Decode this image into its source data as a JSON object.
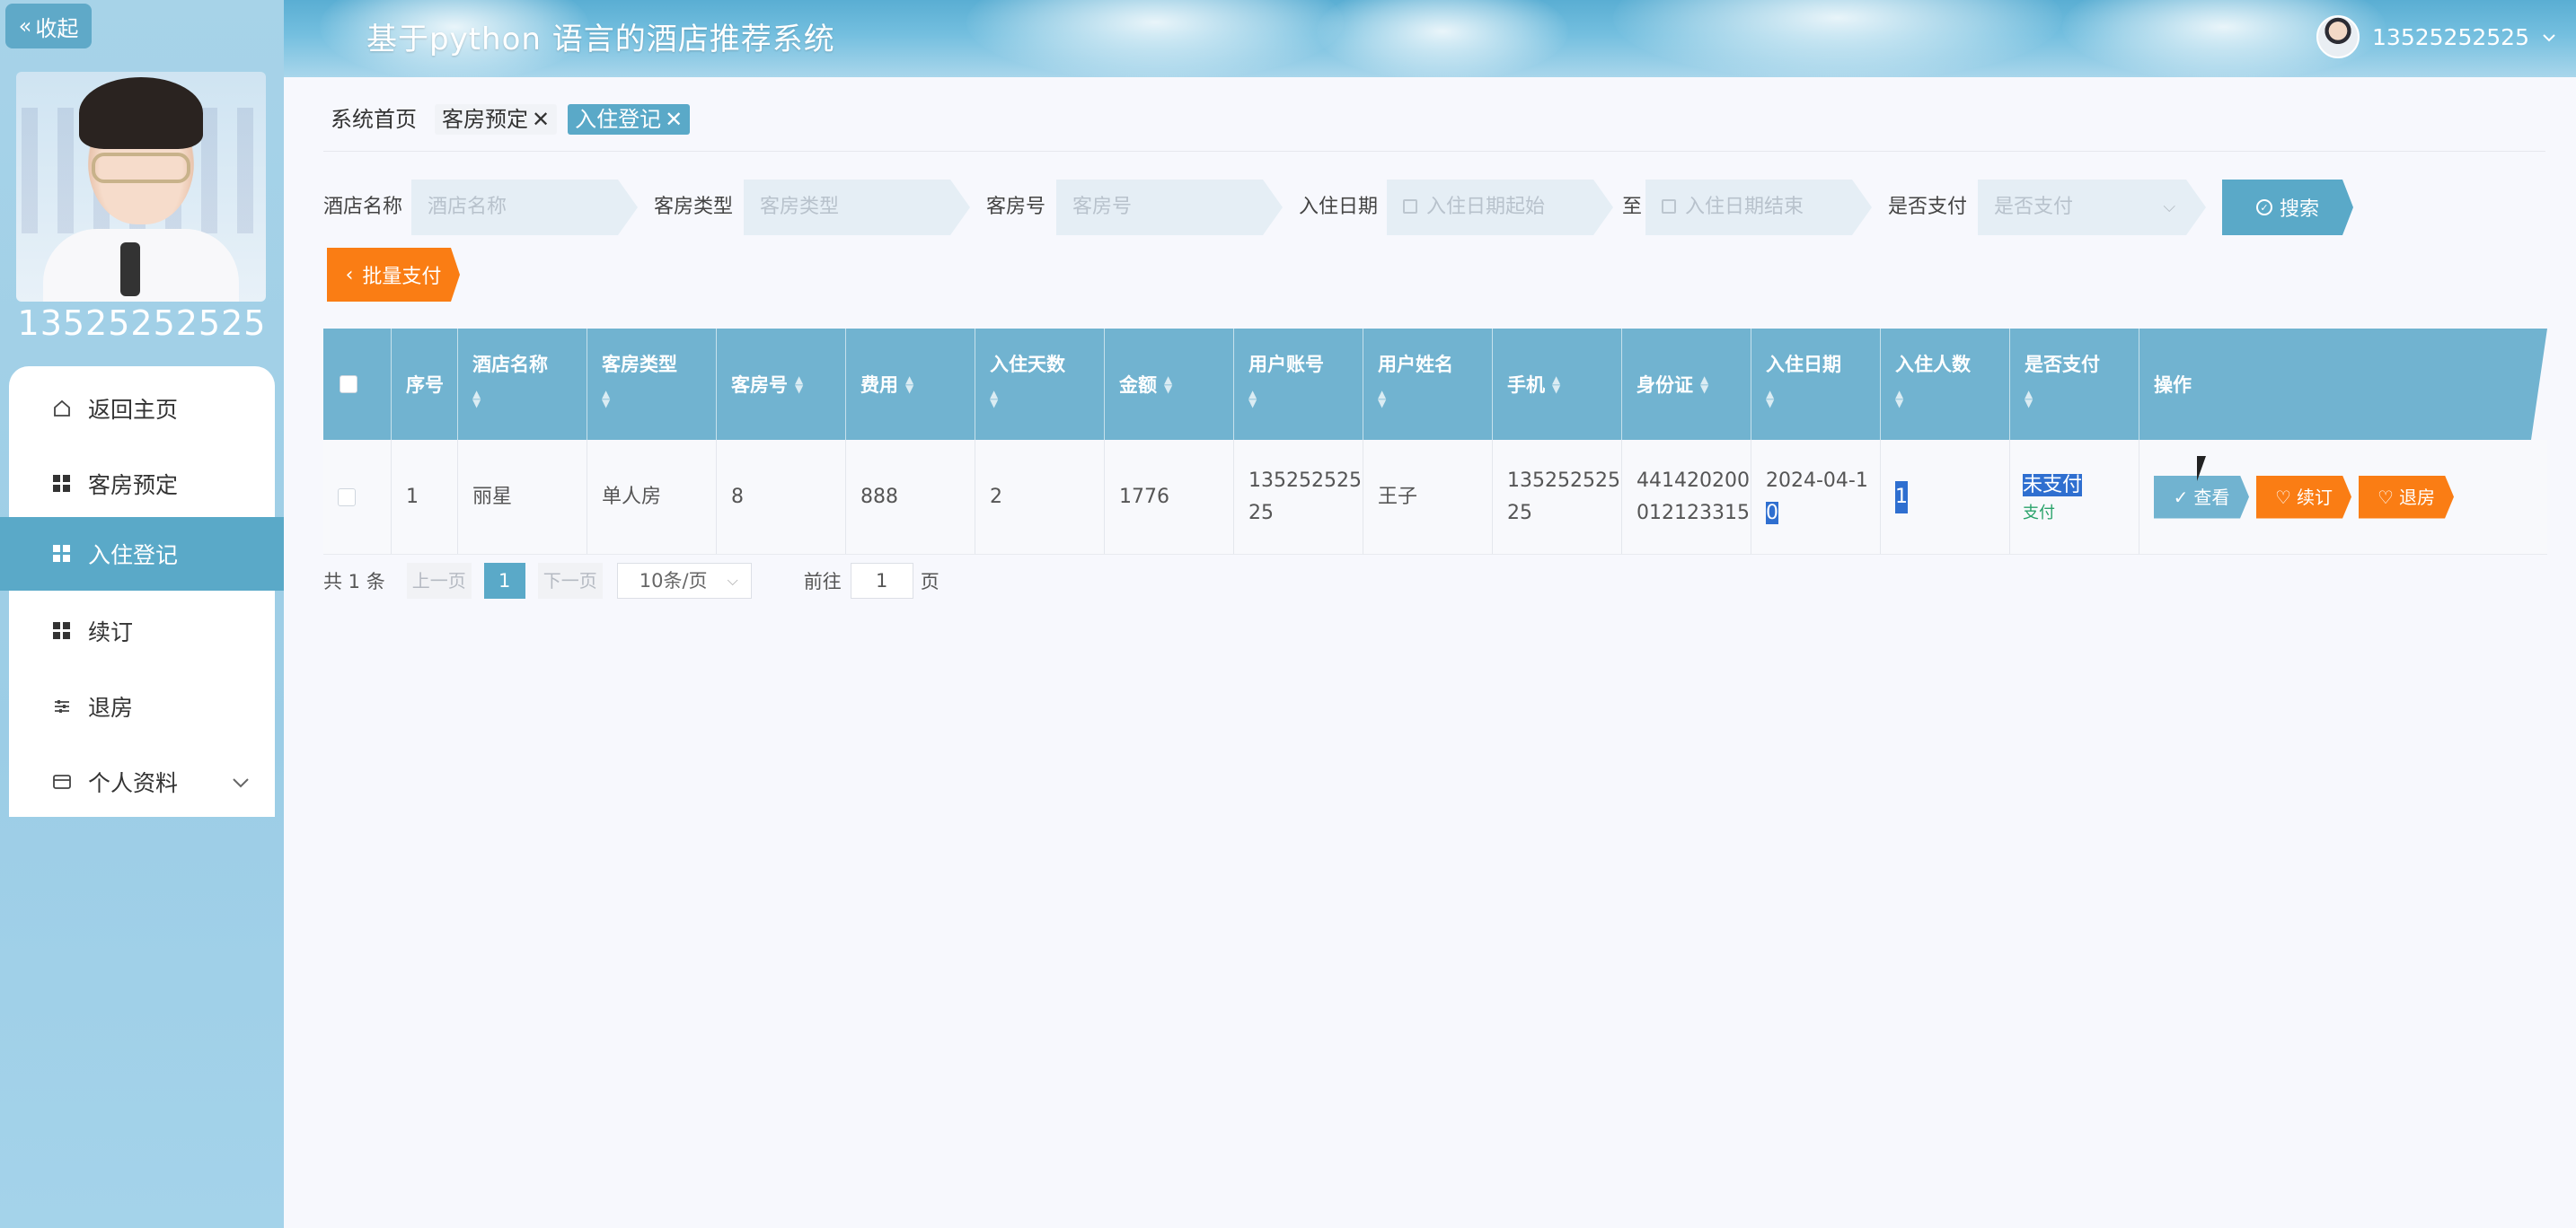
{
  "header": {
    "title": "基于python 语言的酒店推荐系统",
    "username": "13525252525"
  },
  "sidebar": {
    "collapse_label": "收起",
    "profile_name": "13525252525",
    "items": [
      {
        "label": "返回主页",
        "icon": "home-icon"
      },
      {
        "label": "客房预定",
        "icon": "grid-icon"
      },
      {
        "label": "入住登记",
        "icon": "grid-icon",
        "active": true
      },
      {
        "label": "续订",
        "icon": "grid-icon"
      },
      {
        "label": "退房",
        "icon": "sliders-icon"
      },
      {
        "label": "个人资料",
        "icon": "wallet-icon"
      }
    ]
  },
  "tabs": [
    {
      "label": "系统首页"
    },
    {
      "label": "客房预定",
      "closable": true
    },
    {
      "label": "入住登记",
      "closable": true,
      "active": true
    }
  ],
  "search": {
    "hotel_label": "酒店名称",
    "hotel_placeholder": "酒店名称",
    "roomtype_label": "客房类型",
    "roomtype_placeholder": "客房类型",
    "roomno_label": "客房号",
    "roomno_placeholder": "客房号",
    "date_label": "入住日期",
    "date_start_placeholder": "入住日期起始",
    "date_sep": "至",
    "date_end_placeholder": "入住日期结束",
    "paid_label": "是否支付",
    "paid_placeholder": "是否支付",
    "search_button": "搜索"
  },
  "batch_pay_button": "批量支付",
  "table": {
    "headers": [
      "序号",
      "酒店名称",
      "客房类型",
      "客房号",
      "费用",
      "入住天数",
      "金额",
      "用户账号",
      "用户姓名",
      "手机",
      "身份证",
      "入住日期",
      "入住人数",
      "是否支付",
      "操作"
    ],
    "rows": [
      {
        "index": "1",
        "hotel": "丽星",
        "room_type": "单人房",
        "room_no": "8",
        "fee": "888",
        "days": "2",
        "amount": "1776",
        "account_a": "135252525",
        "account_b": "25",
        "name": "王子",
        "phone_a": "135252525",
        "phone_b": "25",
        "id_a": "441420200",
        "id_b": "012123315",
        "date_a": "2024-04-1",
        "date_b": "0",
        "guests": "1",
        "paid_status": "未支付",
        "pay_link": "支付",
        "actions": {
          "view": "查看",
          "renew": "续订",
          "checkout": "退房"
        }
      }
    ]
  },
  "pagination": {
    "total": "共 1 条",
    "prev": "上一页",
    "current": "1",
    "next": "下一页",
    "page_size": "10条/页",
    "goto_label": "前往",
    "goto_value": "1",
    "page_unit": "页"
  },
  "colors": {
    "accent": "#5aa9c8",
    "orange": "#fa7d14",
    "header_blue": "#71b3d0"
  }
}
